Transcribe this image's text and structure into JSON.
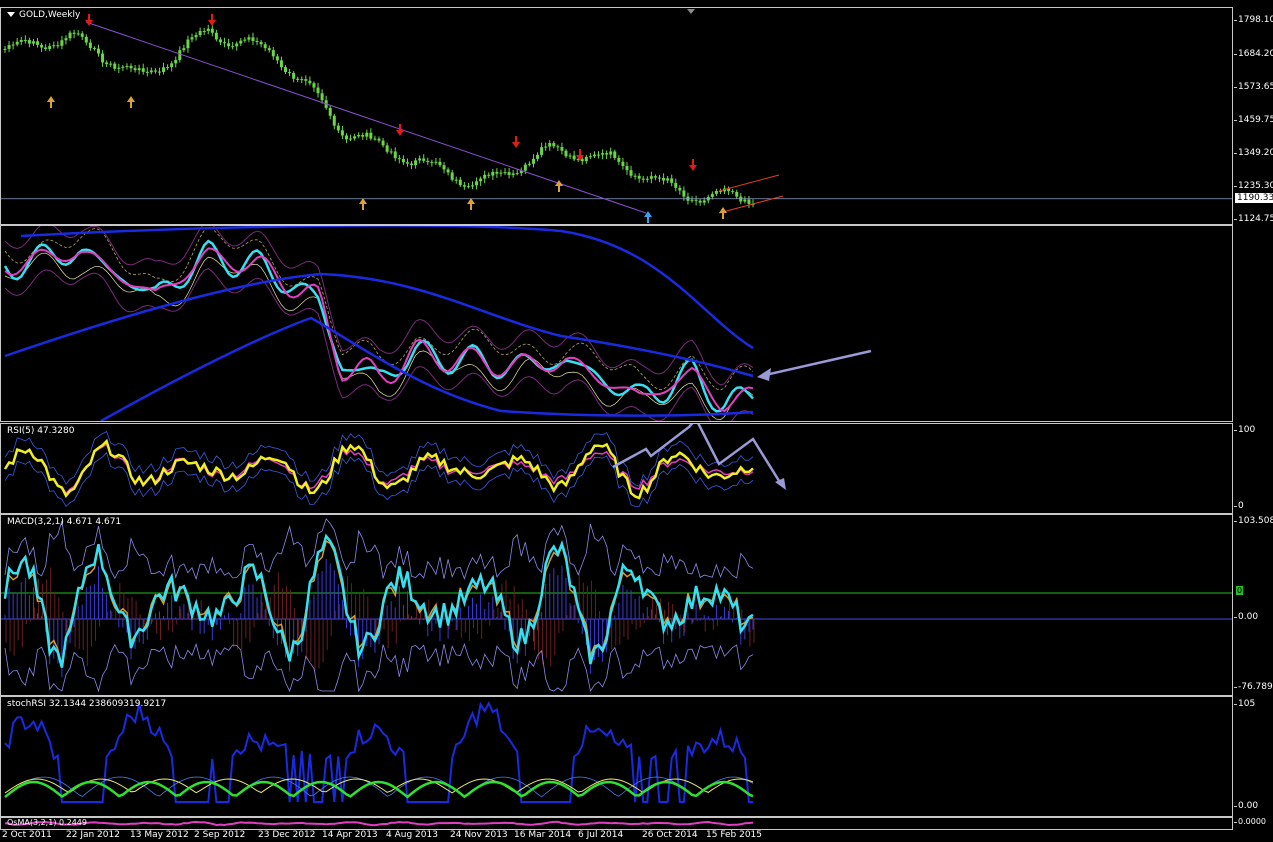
{
  "window": {
    "symbol_title": "GOLD,Weekly"
  },
  "panes": {
    "price": {
      "title": "GOLD,Weekly",
      "ticks": [
        "1798.10",
        "1684.20",
        "1573.65",
        "1459.75",
        "1349.20",
        "1235.30",
        "1124.75"
      ],
      "current_price": "1190.33"
    },
    "ma": {
      "title": ""
    },
    "rsi": {
      "title": "RSI(5) 47.3280",
      "ticks": [
        "100",
        "0"
      ]
    },
    "macd": {
      "title": "MACD(3,2,1) 4.671 4.671",
      "ticks": [
        "103.508",
        "0.00",
        "-76.789"
      ],
      "marker": "0"
    },
    "stoch": {
      "title": "stochRSI 32.1344 238609319.9217",
      "ticks": [
        "105",
        "0.00"
      ]
    },
    "tiny": {
      "title": "OsMA(3,2,1) 0.2449",
      "ticks": [
        "0.0000"
      ]
    }
  },
  "dates": [
    "2 Oct 2011",
    "22 Jan 2012",
    "13 May 2012",
    "2 Sep 2012",
    "23 Dec 2012",
    "14 Apr 2013",
    "4 Aug 2013",
    "24 Nov 2013",
    "16 Mar 2014",
    "6 Jul 2014",
    "26 Oct 2014",
    "15 Feb 2015"
  ],
  "colors": {
    "candle": "#6cd64a",
    "up_arrow": "#d9a23a",
    "down_arrow": "#e01b1b",
    "blue_arrow": "#3aa0e8",
    "cyan": "#35e0f0",
    "magenta": "#e040c0",
    "yellow": "#f0f020",
    "blue": "#1a2ae0",
    "annotation": "#9a9ad8"
  },
  "chart_data": {
    "type": "line",
    "title": "GOLD,Weekly",
    "xlabel": "",
    "ylabel": "",
    "ylim": [
      1124.75,
      1798.1
    ],
    "x": [
      "2 Oct 2011",
      "22 Jan 2012",
      "13 May 2012",
      "2 Sep 2012",
      "23 Dec 2012",
      "14 Apr 2013",
      "4 Aug 2013",
      "24 Nov 2013",
      "16 Mar 2014",
      "6 Jul 2014",
      "26 Oct 2014",
      "15 Feb 2015"
    ],
    "series": [
      {
        "values": [
          1700,
          1740,
          1600,
          1760,
          1680,
          1420,
          1320,
          1240,
          1360,
          1320,
          1200,
          1190
        ]
      }
    ]
  }
}
